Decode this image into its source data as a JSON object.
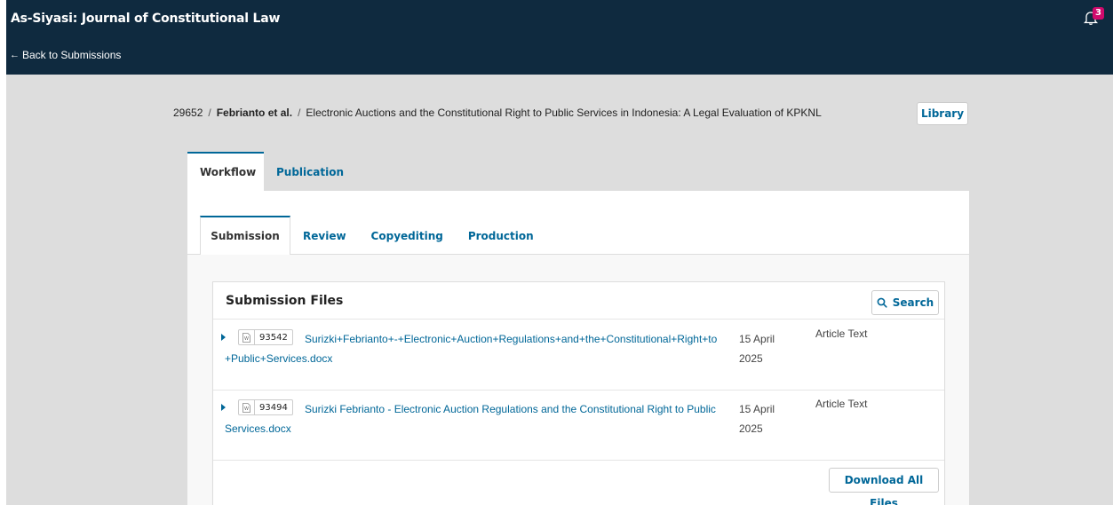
{
  "header": {
    "site_title": "As-Siyasi: Journal of Constitutional Law",
    "back_label": "Back to Submissions",
    "notification_count": "3"
  },
  "breadcrumb": {
    "submission_id": "29652",
    "separator": "/",
    "authors": "Febrianto et al.",
    "title": "Electronic Auctions and the Constitutional Right to Public Services in Indonesia: A Legal Evaluation of KPKNL"
  },
  "library_label": "Library",
  "main_tabs": [
    {
      "label": "Workflow",
      "active": true
    },
    {
      "label": "Publication",
      "active": false
    }
  ],
  "stage_tabs": [
    {
      "label": "Submission",
      "active": true
    },
    {
      "label": "Review",
      "active": false
    },
    {
      "label": "Copyediting",
      "active": false
    },
    {
      "label": "Production",
      "active": false
    }
  ],
  "submission_files": {
    "title": "Submission Files",
    "search_label": "Search",
    "download_all_label": "Download All Files",
    "files": [
      {
        "id": "93542",
        "name": "Surizki+Febrianto+-+Electronic+Auction+Regulations+and+the+Constitutional+Right+to+Public+Services.docx",
        "date": "15 April 2025",
        "type": "Article Text"
      },
      {
        "id": "93494",
        "name": "Surizki Febrianto - Electronic Auction Regulations and the Constitutional Right to Public Services.docx",
        "date": "15 April 2025",
        "type": "Article Text"
      }
    ]
  },
  "colors": {
    "header_bg": "#0f2a3f",
    "link": "#006798",
    "badge": "#d00a6c",
    "page_bg": "#dddddd"
  }
}
